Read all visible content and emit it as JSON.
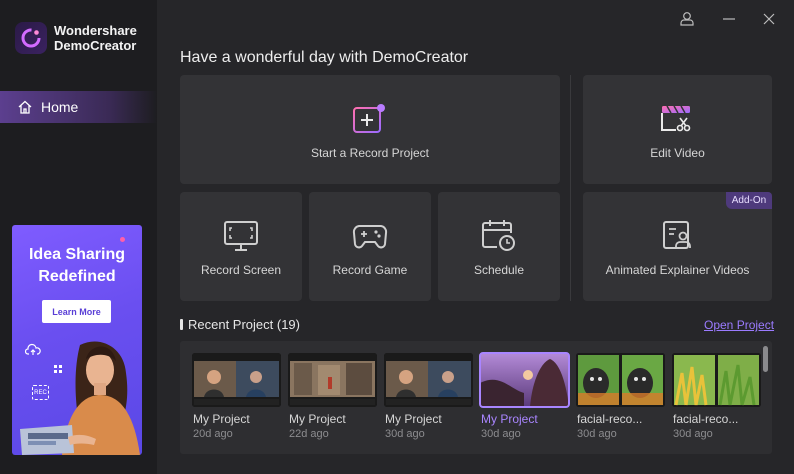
{
  "app": {
    "name_line1": "Wondershare",
    "name_line2": "DemoCreator"
  },
  "sidebar": {
    "home_label": "Home"
  },
  "promo": {
    "title_line1": "Idea Sharing",
    "title_line2": "Redefined",
    "button_label": "Learn More",
    "rec_label": "REC"
  },
  "main": {
    "greeting": "Have a wonderful day with DemoCreator",
    "cards": {
      "start_record_project": "Start a Record Project",
      "edit_video": "Edit Video",
      "record_screen": "Record Screen",
      "record_game": "Record Game",
      "schedule": "Schedule",
      "animated_explainer": "Animated Explainer Videos",
      "addon_badge": "Add-On"
    }
  },
  "recent": {
    "title": "Recent Project (19)",
    "open_project_label": "Open Project",
    "projects": [
      {
        "name": "My Project",
        "date": "20d ago"
      },
      {
        "name": "My Project",
        "date": "22d ago"
      },
      {
        "name": "My Project",
        "date": "30d ago"
      },
      {
        "name": "My Project",
        "date": "30d ago"
      },
      {
        "name": "facial-reco...",
        "date": "30d ago"
      },
      {
        "name": "facial-reco...",
        "date": "30d ago"
      }
    ]
  },
  "colors": {
    "accent": "#a985ff",
    "sidebar_bg": "#1d1d20",
    "main_bg": "#262629",
    "card_bg": "#333336"
  }
}
